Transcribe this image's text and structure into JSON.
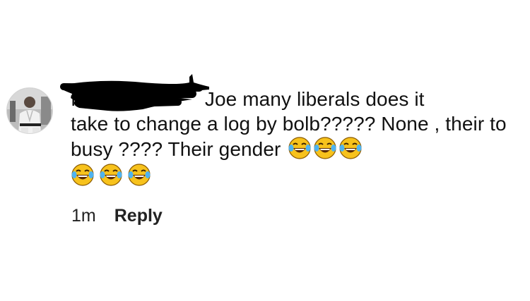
{
  "comment": {
    "author_prefix": "f",
    "text_line1_visible": "Joe many liberals does it",
    "text_rest": "take to change a log by bolb????? None , their to busy ???? Their gender",
    "emoji_name": "face-with-tears-of-joy",
    "emoji_count": 6,
    "timestamp": "1m",
    "reply_label": "Reply"
  },
  "colors": {
    "text": "#111111",
    "redaction": "#000000",
    "emoji_face": "#F7C21C"
  }
}
